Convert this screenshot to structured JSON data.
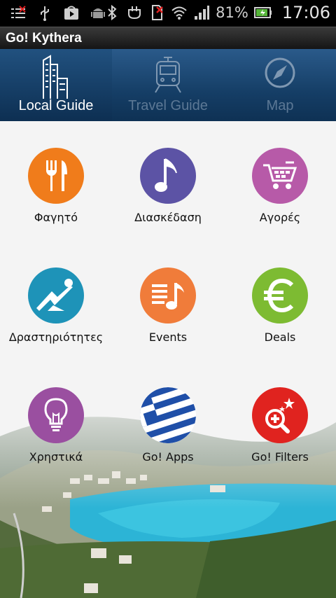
{
  "status_bar": {
    "battery": "81%",
    "time": "17:06"
  },
  "app": {
    "title": "Go! Kythera"
  },
  "tabs": [
    {
      "label": "Local Guide",
      "icon": "buildings-icon",
      "active": true
    },
    {
      "label": "Travel Guide",
      "icon": "train-icon",
      "active": false
    },
    {
      "label": "Map",
      "icon": "compass-icon",
      "active": false
    }
  ],
  "categories": [
    {
      "label": "Φαγητό",
      "icon": "fork-knife-icon",
      "color": "#f07c1b"
    },
    {
      "label": "Διασκέδαση",
      "icon": "music-note-icon",
      "color": "#5c53a5"
    },
    {
      "label": "Αγορές",
      "icon": "shopping-cart-icon",
      "color": "#b75aa8"
    },
    {
      "label": "Δραστηριότητες",
      "icon": "activity-icon",
      "color": "#1e93b8"
    },
    {
      "label": "Events",
      "icon": "music-list-icon",
      "color": "#f07c3a"
    },
    {
      "label": "Deals",
      "icon": "euro-icon",
      "color": "#7dbb32"
    },
    {
      "label": "Χρηστικά",
      "icon": "lightbulb-icon",
      "color": "#9a4fa0"
    },
    {
      "label": "Go! Apps",
      "icon": "greek-flag-icon",
      "color": "#1f4fa8"
    },
    {
      "label": "Go! Filters",
      "icon": "zoom-stars-icon",
      "color": "#e0231f"
    }
  ]
}
